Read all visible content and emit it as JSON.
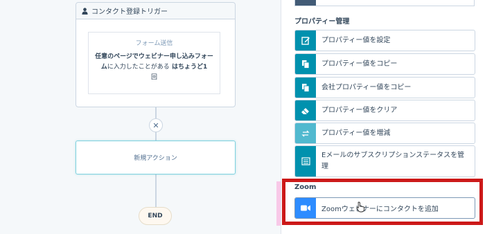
{
  "canvas": {
    "trigger": {
      "title": "コンタクト登録トリガー",
      "form_label": "フォーム送信",
      "condition_bold_1": "任意のページでウェビナー申し込みフォーム",
      "condition_plain": "に入力したことがある",
      "condition_bold_2": "はちょうど1",
      "condition_tail": "回"
    },
    "remove_glyph": "✕",
    "new_action_label": "新規アクション",
    "end_label": "END"
  },
  "panel": {
    "property_section_title": "プロパティー管理",
    "actions": [
      {
        "label": "プロパティー値を設定",
        "icon": "edit-icon"
      },
      {
        "label": "プロパティー値をコピー",
        "icon": "copy-icon"
      },
      {
        "label": "会社プロパティー値をコピー",
        "icon": "copy-icon"
      },
      {
        "label": "プロパティー値をクリア",
        "icon": "eraser-icon"
      },
      {
        "label": "プロパティー値を増減",
        "icon": "swap-arrows-icon"
      },
      {
        "label_line1": "Eメールのサブスクリプションステータスを管",
        "label_line2": "理",
        "icon": "list-icon"
      }
    ],
    "zoom_section_title": "Zoom",
    "zoom_action": {
      "label": "Zoomウェビナーにコンタクトを追加",
      "icon": "video-camera-icon"
    }
  },
  "colors": {
    "icon_teal": "#0091ae",
    "icon_teal_light": "#51b9cf",
    "zoom_blue": "#2d8cff",
    "highlight_red": "#cc1919"
  }
}
